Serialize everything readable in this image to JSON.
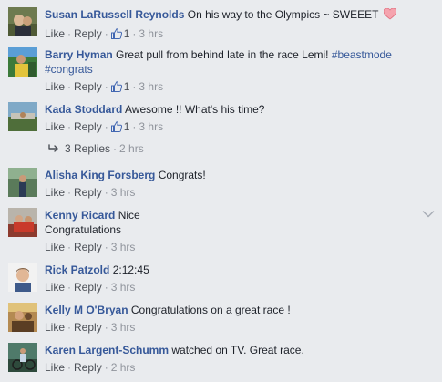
{
  "actions": {
    "like": "Like",
    "reply": "Reply",
    "sep": "·"
  },
  "comments": [
    {
      "author": "Susan LaRussell Reynolds",
      "text": "On his way to the Olympics ~ SWEEET",
      "likes": "1",
      "time": "3 hrs",
      "emoji": "heart-icon"
    },
    {
      "author": "Barry Hyman",
      "text": "Great pull from behind late in the race Lemi!",
      "hashtag1": "#beastmode",
      "hashtag2": "#congrats",
      "likes": "1",
      "time": "3 hrs"
    },
    {
      "author": "Kada Stoddard",
      "text": "Awesome !! What's his time?",
      "likes": "1",
      "time": "3 hrs"
    },
    {
      "author": "Alisha King Forsberg",
      "text": "Congrats!",
      "time": "3 hrs"
    },
    {
      "author": "Kenny Ricard",
      "text": "Nice",
      "text2": "Congratulations",
      "time": "3 hrs"
    },
    {
      "author": "Rick Patzold",
      "text": "2:12:45",
      "time": "3 hrs"
    },
    {
      "author": "Kelly M O'Bryan",
      "text": "Congratulations on a great race !",
      "time": "3 hrs"
    },
    {
      "author": "Karen Largent-Schumm",
      "text": "watched on TV. Great race.",
      "time": "2 hrs"
    }
  ],
  "replies": {
    "label": "3 Replies",
    "time": "2 hrs"
  },
  "colors": {
    "background": "#e9ebee",
    "link": "#365899",
    "meta": "#90949c",
    "action": "#4b4f56",
    "like_icon": "#4267b2",
    "heart": "#f25268"
  }
}
